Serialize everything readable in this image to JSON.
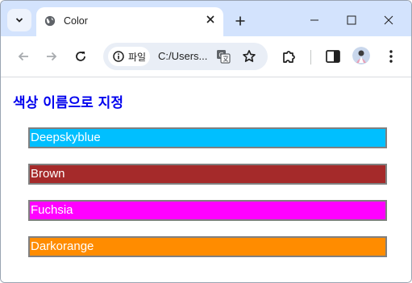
{
  "browser": {
    "tab_title": "Color",
    "omnibox": {
      "chip_label": "파일",
      "url": "C:/Users..."
    }
  },
  "page": {
    "heading": "색상 이름으로 지정",
    "heading_color": "#0000ee",
    "boxes": [
      {
        "label": "Deepskyblue",
        "color": "#00bfff"
      },
      {
        "label": "Brown",
        "color": "#a52a2a"
      },
      {
        "label": "Fuchsia",
        "color": "#ff00ff"
      },
      {
        "label": "Darkorange",
        "color": "#ff8c00"
      }
    ]
  },
  "icons": {
    "tab_search": "chevron-down-icon",
    "favicon": "globe-icon",
    "tab_close": "close-icon",
    "new_tab": "plus-icon",
    "back": "arrow-left-icon",
    "forward": "arrow-right-icon",
    "reload": "reload-icon",
    "info": "info-icon",
    "translate": "translate-icon",
    "bookmark": "star-icon",
    "extensions": "puzzle-icon",
    "side_panel": "side-panel-icon",
    "profile": "avatar",
    "menu": "kebab-menu-icon"
  }
}
